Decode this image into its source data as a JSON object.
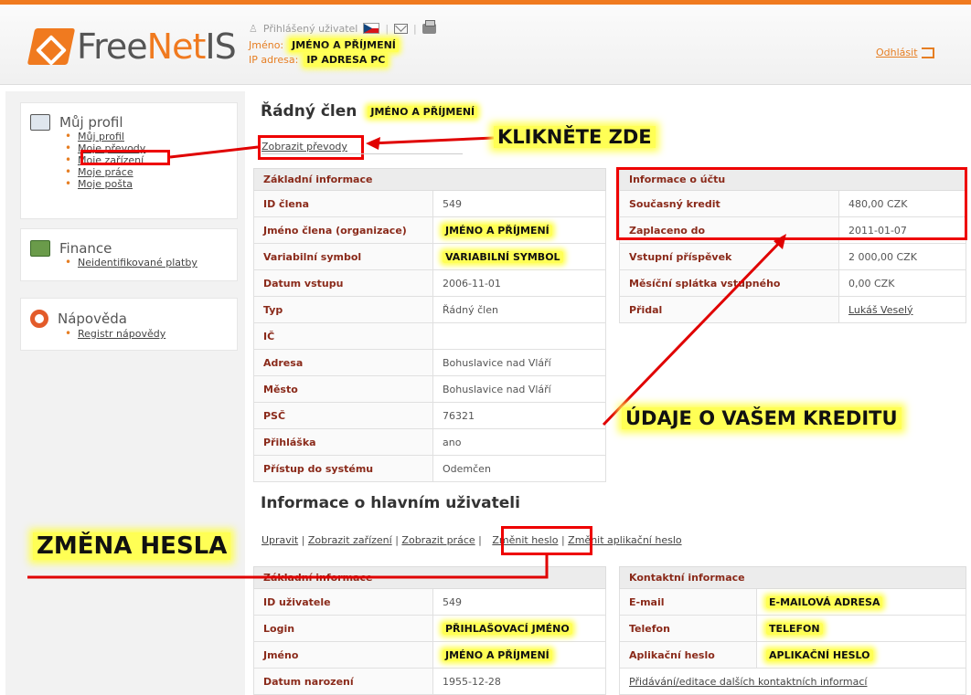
{
  "header": {
    "logo": {
      "free": "Free",
      "net": "Net",
      "is": "IS"
    },
    "logged_user_label": "Přihlášený uživatel",
    "name_label": "Jméno:",
    "name_value": "JMÉNO A PŘÍJMENÍ",
    "ip_label": "IP adresa:",
    "ip_value": "IP ADRESA PC",
    "logout": "Odhlásit"
  },
  "sidebar": {
    "profile": {
      "title": "Můj profil",
      "items": [
        "Můj profil",
        "Moje převody",
        "Moje zařízení",
        "Moje práce",
        "Moje pošta"
      ]
    },
    "finance": {
      "title": "Finance",
      "items": [
        "Neidentifikované platby"
      ]
    },
    "help": {
      "title": "Nápověda",
      "items": [
        "Registr nápovědy"
      ]
    }
  },
  "main": {
    "title": "Řádný člen",
    "title_name": "JMÉNO A PŘÍJMENÍ",
    "top_link": "Zobrazit převody",
    "basic_info": {
      "header": "Základní informace",
      "rows": [
        {
          "k": "ID člena",
          "v": "549"
        },
        {
          "k": "Jméno člena (organizace)",
          "v": "JMÉNO A PŘÍJMENÍ"
        },
        {
          "k": "Variabilní symbol",
          "v": "VARIABILNÍ SYMBOL"
        },
        {
          "k": "Datum vstupu",
          "v": "2006-11-01"
        },
        {
          "k": "Typ",
          "v": "Řádný člen"
        },
        {
          "k": "IČ",
          "v": ""
        },
        {
          "k": "Adresa",
          "v": "Bohuslavice nad Vláří"
        },
        {
          "k": "Město",
          "v": "Bohuslavice nad Vláří"
        },
        {
          "k": "PSČ",
          "v": "76321"
        },
        {
          "k": "Přihláška",
          "v": "ano"
        },
        {
          "k": "Přístup do systému",
          "v": "Odemčen"
        }
      ]
    },
    "account_info": {
      "header": "Informace o účtu",
      "rows": [
        {
          "k": "Současný kredit",
          "v": "480,00 CZK"
        },
        {
          "k": "Zaplaceno do",
          "v": "2011-01-07"
        },
        {
          "k": "Vstupní příspěvek",
          "v": "2 000,00 CZK"
        },
        {
          "k": "Měsíční splátka vstupného",
          "v": "0,00 CZK"
        },
        {
          "k": "Přidal",
          "v": "Lukáš Veselý"
        }
      ]
    },
    "main_user": {
      "title": "Informace o hlavním uživateli",
      "links": [
        "Upravit",
        "Zobrazit zařízení",
        "Zobrazit práce",
        "Změnit heslo",
        "Změnit aplikační heslo"
      ],
      "basic": {
        "header": "Základní informace",
        "rows": [
          {
            "k": "ID uživatele",
            "v": "549"
          },
          {
            "k": "Login",
            "v": "PŘIHLAŠOVACÍ JMÉNO"
          },
          {
            "k": "Jméno",
            "v": "JMÉNO A PŘÍJMENÍ"
          },
          {
            "k": "Datum narození",
            "v": "1955-12-28"
          }
        ]
      },
      "contact": {
        "header": "Kontaktní informace",
        "rows": [
          {
            "k": "E-mail",
            "v": "E-MAILOVÁ ADRESA"
          },
          {
            "k": "Telefon",
            "v": "TELEFON"
          },
          {
            "k": "Aplikační heslo",
            "v": "APLIKAČNÍ HESLO"
          }
        ],
        "footer_link": "Přidávání/editace dalších kontaktních informací"
      }
    }
  },
  "annotations": {
    "click_here": "KLIKNĚTE ZDE",
    "credit": "ÚDAJE O VAŠEM KREDITU",
    "password": "ZMĚNA HESLA"
  },
  "colors": {
    "accent": "#f07a1f",
    "highlight": "#ffff55",
    "annotation_red": "#e00000",
    "label_text": "#8a2a1a"
  }
}
